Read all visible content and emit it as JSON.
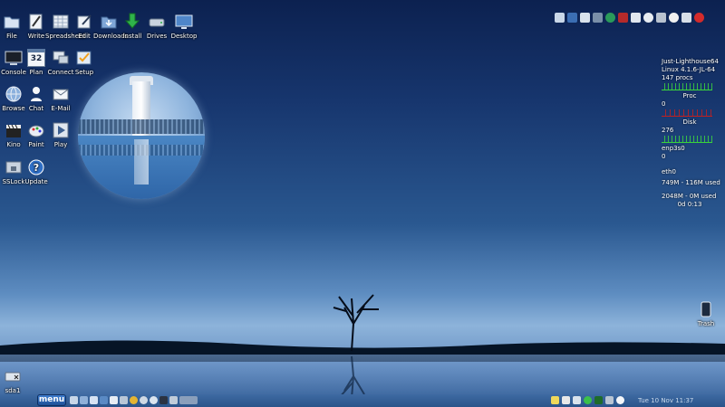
{
  "desktop_icons": [
    {
      "label": "File",
      "icon": "folder-icon"
    },
    {
      "label": "Write",
      "icon": "write-icon"
    },
    {
      "label": "Spreadsheet",
      "icon": "spreadsheet-icon"
    },
    {
      "label": "Edit",
      "icon": "edit-icon"
    },
    {
      "label": "Downloads",
      "icon": "downloads-folder-icon"
    },
    {
      "label": "Install",
      "icon": "install-icon"
    },
    {
      "label": "Drives",
      "icon": "drives-icon"
    },
    {
      "label": "Desktop",
      "icon": "desktop-icon"
    },
    {
      "label": "Console",
      "icon": "console-icon"
    },
    {
      "label": "Plan",
      "icon": "calendar-icon",
      "badge": "32"
    },
    {
      "label": "Connect",
      "icon": "connect-icon"
    },
    {
      "label": "Setup",
      "icon": "setup-icon"
    },
    {
      "label": "Browse",
      "icon": "globe-icon"
    },
    {
      "label": "Chat",
      "icon": "chat-icon"
    },
    {
      "label": "E-Mail",
      "icon": "email-icon"
    },
    {
      "label": "Kino",
      "icon": "clapperboard-icon"
    },
    {
      "label": "Paint",
      "icon": "paint-icon"
    },
    {
      "label": "Play",
      "icon": "play-icon"
    },
    {
      "label": "SSLock",
      "icon": "lock-screen-icon"
    },
    {
      "label": "Update",
      "icon": "help-update-icon"
    },
    {
      "label": "Trash",
      "icon": "trash-icon"
    },
    {
      "label": "sda1",
      "icon": "drive-icon"
    }
  ],
  "conky": {
    "hostname": "Just-Lighthouse64",
    "kernel": "Linux 4.1.6-JL-64",
    "procs": "147 procs",
    "proc_title": "Proc",
    "proc_value": "0",
    "disk_title": "Disk",
    "disk_value": "276",
    "net1_name": "enp3s0",
    "net1_value": "0",
    "net2_name": "eth0",
    "mem": "749M - 116M used",
    "swap": "2048M - 0M used",
    "uptime": "0d  0:13"
  },
  "taskbar": {
    "menu_label": "menu",
    "clock": "Tue 10 Nov  11:37"
  },
  "colors": {
    "accent": "#1d4f96",
    "graph_green": "#3ad43a",
    "graph_red": "#c02020"
  }
}
